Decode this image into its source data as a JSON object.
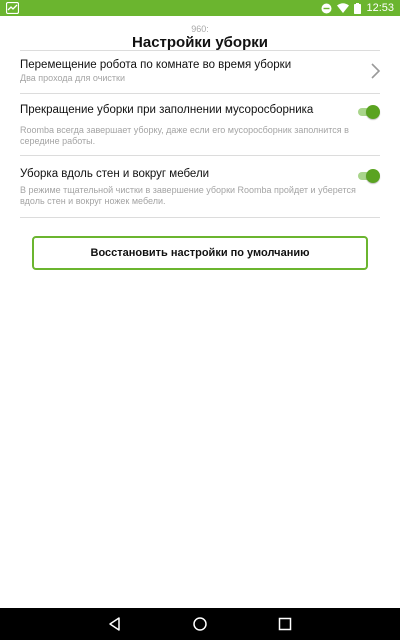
{
  "status_bar": {
    "time": "12:53",
    "icons": [
      "app-badge-icon",
      "minus-circle-icon",
      "wifi-icon",
      "battery-icon"
    ]
  },
  "header": {
    "model": "960:",
    "title": "Настройки уборки"
  },
  "settings": [
    {
      "title": "Перемещение робота по комнате во время уборки",
      "subtitle": "Два прохода для очистки",
      "control": "chevron-right-icon"
    },
    {
      "title": "Прекращение уборки при заполнении мусоросборника",
      "subtitle": "Roomba всегда завершает уборку, даже если его мусоросборник заполнится в середине работы.",
      "control": "toggle",
      "state": "on"
    },
    {
      "title": "Уборка вдоль стен и вокруг мебели",
      "subtitle": "В режиме тщательной чистки в завершение уборки Roomba пройдет и уберется вдоль стен и вокруг ножек мебели.",
      "control": "toggle",
      "state": "on"
    }
  ],
  "reset_button": {
    "label": "Восстановить настройки по умолчанию"
  },
  "nav_bar": {
    "icons": [
      "back-icon",
      "home-icon",
      "recents-icon"
    ]
  },
  "colors": {
    "accent": "#6bb52f",
    "toggle_thumb": "#5aa321",
    "toggle_track": "#a9d58b",
    "divider": "#dcdcdc",
    "subtitle": "#a4a4a4"
  }
}
